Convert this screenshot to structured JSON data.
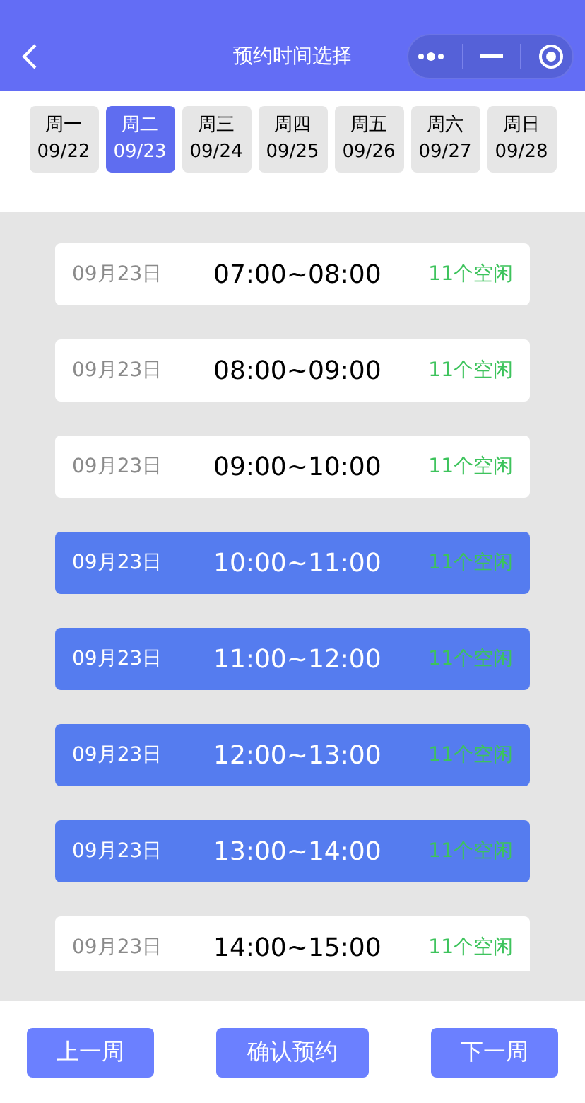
{
  "header": {
    "title": "预约时间选择"
  },
  "days": [
    {
      "weekday": "周一",
      "date": "09/22",
      "selected": false
    },
    {
      "weekday": "周二",
      "date": "09/23",
      "selected": true
    },
    {
      "weekday": "周三",
      "date": "09/24",
      "selected": false
    },
    {
      "weekday": "周四",
      "date": "09/25",
      "selected": false
    },
    {
      "weekday": "周五",
      "date": "09/26",
      "selected": false
    },
    {
      "weekday": "周六",
      "date": "09/27",
      "selected": false
    },
    {
      "weekday": "周日",
      "date": "09/28",
      "selected": false
    }
  ],
  "slots": [
    {
      "date": "09月23日",
      "time": "07:00~08:00",
      "availability": "11个空闲",
      "selected": false
    },
    {
      "date": "09月23日",
      "time": "08:00~09:00",
      "availability": "11个空闲",
      "selected": false
    },
    {
      "date": "09月23日",
      "time": "09:00~10:00",
      "availability": "11个空闲",
      "selected": false
    },
    {
      "date": "09月23日",
      "time": "10:00~11:00",
      "availability": "11个空闲",
      "selected": true
    },
    {
      "date": "09月23日",
      "time": "11:00~12:00",
      "availability": "11个空闲",
      "selected": true
    },
    {
      "date": "09月23日",
      "time": "12:00~13:00",
      "availability": "11个空闲",
      "selected": true
    },
    {
      "date": "09月23日",
      "time": "13:00~14:00",
      "availability": "11个空闲",
      "selected": true
    },
    {
      "date": "09月23日",
      "time": "14:00~15:00",
      "availability": "11个空闲",
      "selected": false
    }
  ],
  "footer": {
    "buttons": [
      "上一周",
      "确认预约",
      "下一周"
    ]
  }
}
